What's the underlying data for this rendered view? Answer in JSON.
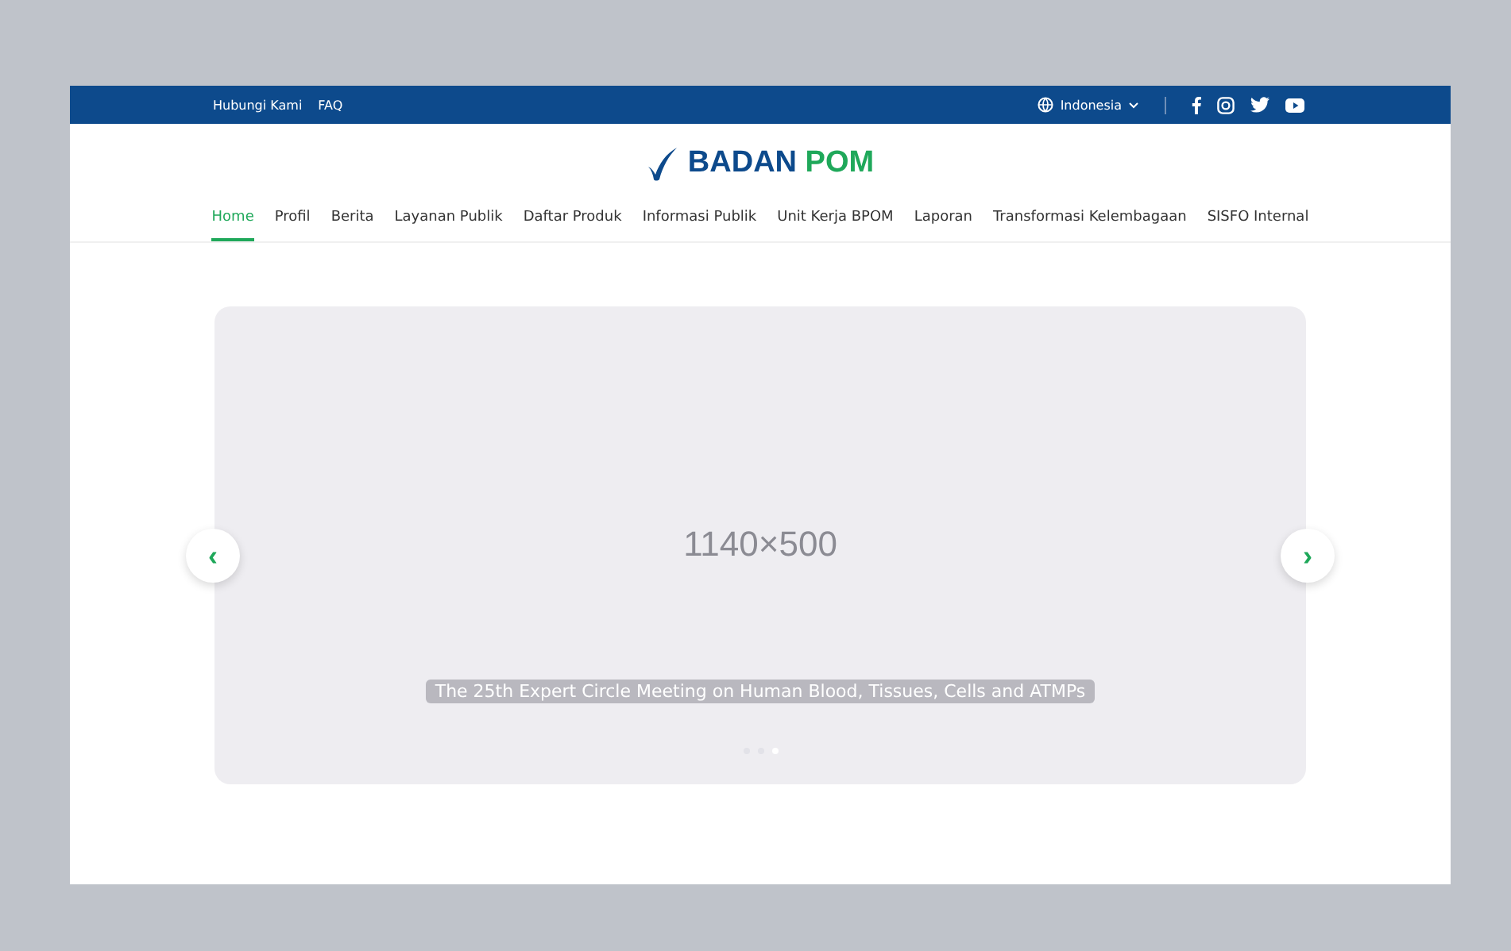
{
  "top_bar": {
    "links": [
      "Hubungi Kami",
      "FAQ"
    ],
    "language": "Indonesia"
  },
  "logo": {
    "part_1": "BADAN",
    "part_2": "POM"
  },
  "nav": [
    {
      "label": "Home",
      "selected": true
    },
    {
      "label": "Profil",
      "selected": false
    },
    {
      "label": "Berita",
      "selected": false
    },
    {
      "label": "Layanan Publik",
      "selected": false
    },
    {
      "label": "Daftar Produk",
      "selected": false
    },
    {
      "label": "Informasi Publik",
      "selected": false
    },
    {
      "label": "Unit Kerja BPOM",
      "selected": false
    },
    {
      "label": "Laporan",
      "selected": false
    },
    {
      "label": "Transformasi Kelembagaan",
      "selected": false
    },
    {
      "label": "SISFO Internal",
      "selected": false
    }
  ],
  "carousel": {
    "placeholder_text": "1140×500",
    "caption": "The 25th Expert Circle Meeting on Human Blood, Tissues, Cells and ATMPs",
    "prev": "‹",
    "next": "›",
    "dots": [
      {
        "selected": false
      },
      {
        "selected": false
      },
      {
        "selected": true
      }
    ]
  }
}
